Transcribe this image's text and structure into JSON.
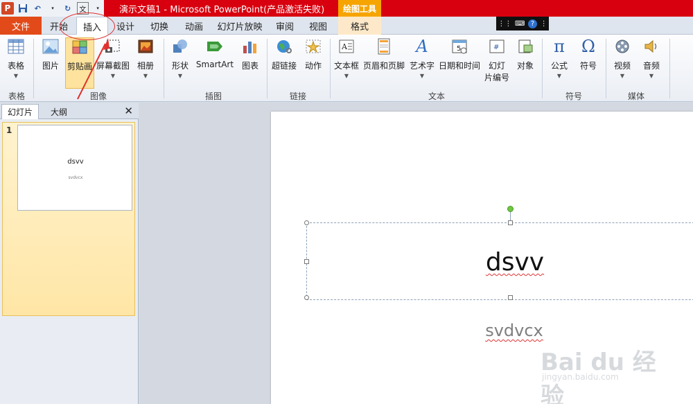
{
  "titlebar": {
    "title": "演示文稿1 - Microsoft PowerPoint(产品激活失败)",
    "tools_tab": "绘图工具"
  },
  "tabs": {
    "file": "文件",
    "items": [
      "开始",
      "插入",
      "设计",
      "切换",
      "动画",
      "幻灯片放映",
      "审阅",
      "视图",
      "格式"
    ],
    "active": "插入"
  },
  "ribbon": {
    "buttons": {
      "table": "表格",
      "picture": "图片",
      "clipart": "剪贴画",
      "screenshot": "屏幕截图",
      "album": "相册",
      "shapes": "形状",
      "smartart": "SmartArt",
      "chart": "图表",
      "hyperlink": "超链接",
      "action": "动作",
      "textbox": "文本框",
      "header_footer": "页眉和页脚",
      "wordart": "艺术字",
      "datetime": "日期和时间",
      "slide_number_1": "幻灯",
      "slide_number_2": "片编号",
      "object": "对象",
      "equation": "公式",
      "symbol": "符号",
      "video": "视频",
      "audio": "音频"
    },
    "groups": {
      "tables": "表格",
      "images": "图像",
      "illustrations": "插图",
      "links": "链接",
      "text": "文本",
      "symbols": "符号",
      "media": "媒体"
    }
  },
  "leftpane": {
    "tab_slides": "幻灯片",
    "tab_outline": "大纲",
    "slide_number": "1",
    "thumb_title": "dsvv",
    "thumb_sub": "svdvcx"
  },
  "slide": {
    "title": "dsvv",
    "subtitle": "svdvcx"
  },
  "watermark": {
    "text": "Bai du 经验",
    "sub": "jingyan.baidu.com"
  },
  "colors": {
    "titlebar": "#d8000f",
    "file_tab": "#e24b19",
    "tools_tab": "#f6a400",
    "annotation": "#e0302e"
  }
}
